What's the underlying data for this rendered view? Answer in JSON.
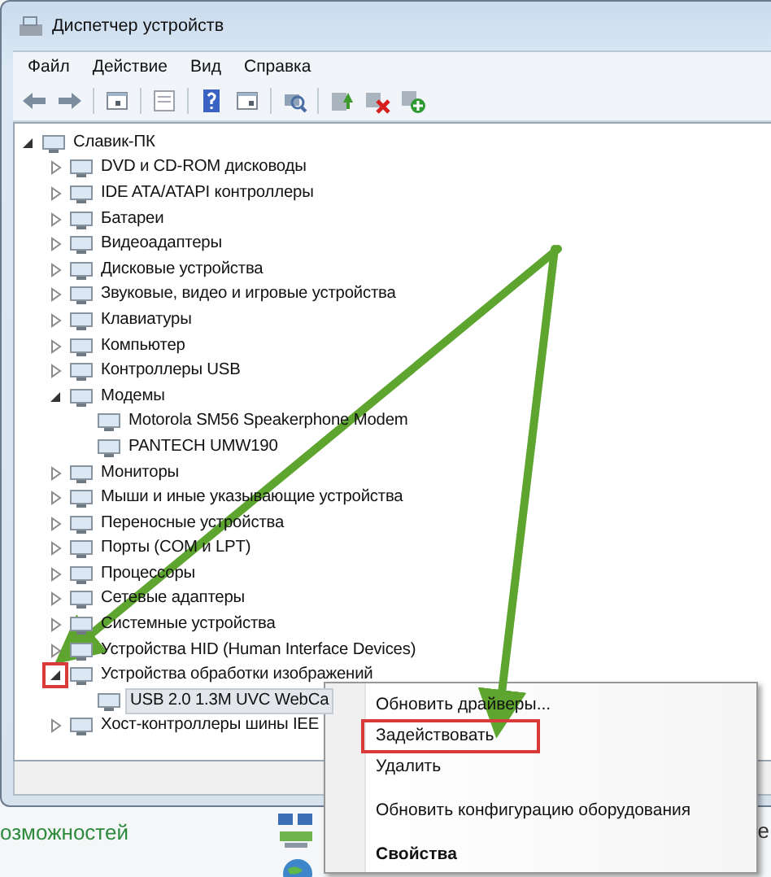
{
  "window": {
    "title": "Диспетчер устройств"
  },
  "menu_bar": [
    {
      "label": "Файл"
    },
    {
      "label": "Действие"
    },
    {
      "label": "Вид"
    },
    {
      "label": "Справка"
    }
  ],
  "tree": [
    {
      "label": "Славик-ПК",
      "expanded": true,
      "selected": false,
      "marked": false,
      "children": [
        {
          "label": "DVD и CD-ROM дисководы",
          "expanded": false,
          "selected": false,
          "marked": false
        },
        {
          "label": "IDE ATA/ATAPI контроллеры",
          "expanded": false,
          "selected": false,
          "marked": false
        },
        {
          "label": "Батареи",
          "expanded": false,
          "selected": false,
          "marked": false
        },
        {
          "label": "Видеоадаптеры",
          "expanded": false,
          "selected": false,
          "marked": false
        },
        {
          "label": "Дисковые устройства",
          "expanded": false,
          "selected": false,
          "marked": false
        },
        {
          "label": "Звуковые, видео и игровые устройства",
          "expanded": false,
          "selected": false,
          "marked": false
        },
        {
          "label": "Клавиатуры",
          "expanded": false,
          "selected": false,
          "marked": false
        },
        {
          "label": "Компьютер",
          "expanded": false,
          "selected": false,
          "marked": false
        },
        {
          "label": "Контроллеры USB",
          "expanded": false,
          "selected": false,
          "marked": false
        },
        {
          "label": "Модемы",
          "expanded": true,
          "selected": false,
          "marked": false,
          "children": [
            {
              "label": "Motorola SM56 Speakerphone Modem",
              "selected": false
            },
            {
              "label": "PANTECH UMW190",
              "selected": false
            }
          ]
        },
        {
          "label": "Мониторы",
          "expanded": false,
          "selected": false,
          "marked": false
        },
        {
          "label": "Мыши и иные указывающие устройства",
          "expanded": false,
          "selected": false,
          "marked": false
        },
        {
          "label": "Переносные устройства",
          "expanded": false,
          "selected": false,
          "marked": false
        },
        {
          "label": "Порты (COM и LPT)",
          "expanded": false,
          "selected": false,
          "marked": false
        },
        {
          "label": "Процессоры",
          "expanded": false,
          "selected": false,
          "marked": false
        },
        {
          "label": "Сетевые адаптеры",
          "expanded": false,
          "selected": false,
          "marked": false
        },
        {
          "label": "Системные устройства",
          "expanded": false,
          "selected": false,
          "marked": false
        },
        {
          "label": "Устройства HID (Human Interface Devices)",
          "expanded": false,
          "selected": false,
          "marked": false
        },
        {
          "label": "Устройства обработки изображений",
          "expanded": true,
          "selected": false,
          "marked": true,
          "children": [
            {
              "label": "USB 2.0 1.3M UVC WebCa",
              "selected": true
            }
          ]
        },
        {
          "label": "Хост-контроллеры шины IEE",
          "expanded": false,
          "selected": false,
          "marked": false
        }
      ]
    }
  ],
  "context_menu": [
    {
      "kind": "item",
      "label": "Обновить драйверы...",
      "bold": false,
      "marked": false
    },
    {
      "kind": "item",
      "label": "Задействовать",
      "bold": false,
      "marked": true
    },
    {
      "kind": "item",
      "label": "Удалить",
      "bold": false,
      "marked": false
    },
    {
      "kind": "separator"
    },
    {
      "kind": "item",
      "label": "Обновить конфигурацию оборудования",
      "bold": false,
      "marked": false
    },
    {
      "kind": "separator"
    },
    {
      "kind": "item",
      "label": "Свойства",
      "bold": true,
      "marked": false
    }
  ],
  "desktop": {
    "left_text": "озможностей",
    "right_text": "е"
  }
}
